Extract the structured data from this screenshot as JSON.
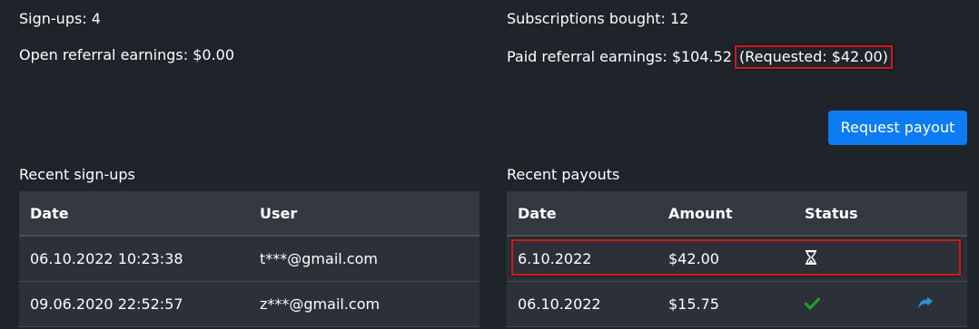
{
  "stats": {
    "signups": "Sign-ups: 4",
    "open_earnings": "Open referral earnings: $0.00",
    "subscriptions": "Subscriptions bought: 12",
    "paid_earnings": "Paid referral earnings: $104.52",
    "requested": "(Requested: $42.00)"
  },
  "actions": {
    "request_payout": "Request payout"
  },
  "signups_section": {
    "title": "Recent sign-ups",
    "columns": [
      "Date",
      "User"
    ],
    "rows": [
      [
        "06.10.2022 10:23:38",
        "t***@gmail.com"
      ],
      [
        "09.06.2020 22:52:57",
        "z***@gmail.com"
      ]
    ]
  },
  "payouts_section": {
    "title": "Recent payouts",
    "columns": [
      "Date",
      "Amount",
      "Status",
      ""
    ],
    "rows": [
      {
        "date": "6.10.2022",
        "amount": "$42.00",
        "status_icon": "hourglass-icon"
      },
      {
        "date": "06.10.2022",
        "amount": "$15.75",
        "status_icon": "checkmark-icon",
        "action_icon": "share-arrow-icon"
      }
    ]
  },
  "colors": {
    "background": "#1f232a",
    "table_header": "#343840",
    "table_row": "#2c3038",
    "primary_button": "#0d7cf2",
    "highlight_border": "#d11a1a",
    "success": "#1f9e2c",
    "link": "#2e8fd6"
  }
}
